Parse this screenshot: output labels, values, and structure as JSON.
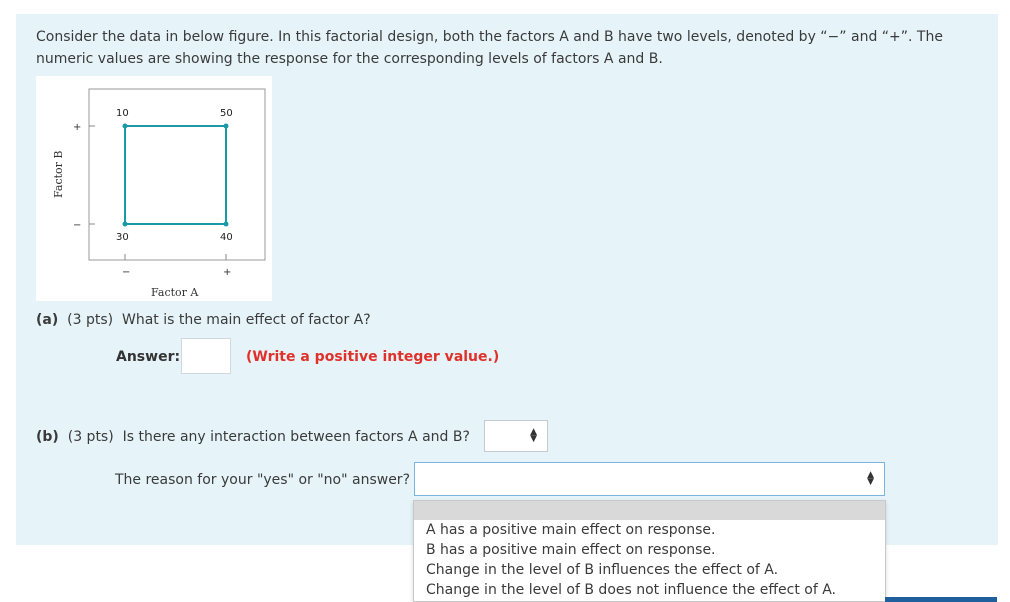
{
  "question": {
    "intro": "Consider the data in below figure. In this factorial design, both the factors A and B have two levels, denoted by “−” and “+”. The numeric values are showing the response for the corresponding levels of factors A and B."
  },
  "figure": {
    "values": {
      "a_minus_b_plus": "10",
      "a_plus_b_plus": "50",
      "a_minus_b_minus": "30",
      "a_plus_b_minus": "40"
    },
    "x_axis_label": "Factor A",
    "y_axis_label": "Factor B",
    "tick_minus": "−",
    "tick_plus": "+",
    "line_color": "#1a9aa6"
  },
  "part_a": {
    "label": "(a)",
    "points": "(3 pts)",
    "text": "What is the main effect of factor A?",
    "answer_label": "Answer:",
    "answer_value": "",
    "hint": "(Write a positive integer value.)",
    "hint_color": "#e0302a"
  },
  "part_b": {
    "label": "(b)",
    "points": "(3 pts)",
    "text": "Is there any interaction between factors A and B?",
    "select_value": "",
    "reason_label": "The reason for your \"yes\" or \"no\" answer?",
    "reason_value": "",
    "reason_options": [
      "A has a positive main effect on response.",
      "B has a positive main effect on response.",
      "Change in the level of B influences the effect of A.",
      "Change in the level of B does not influence the effect of A."
    ]
  }
}
